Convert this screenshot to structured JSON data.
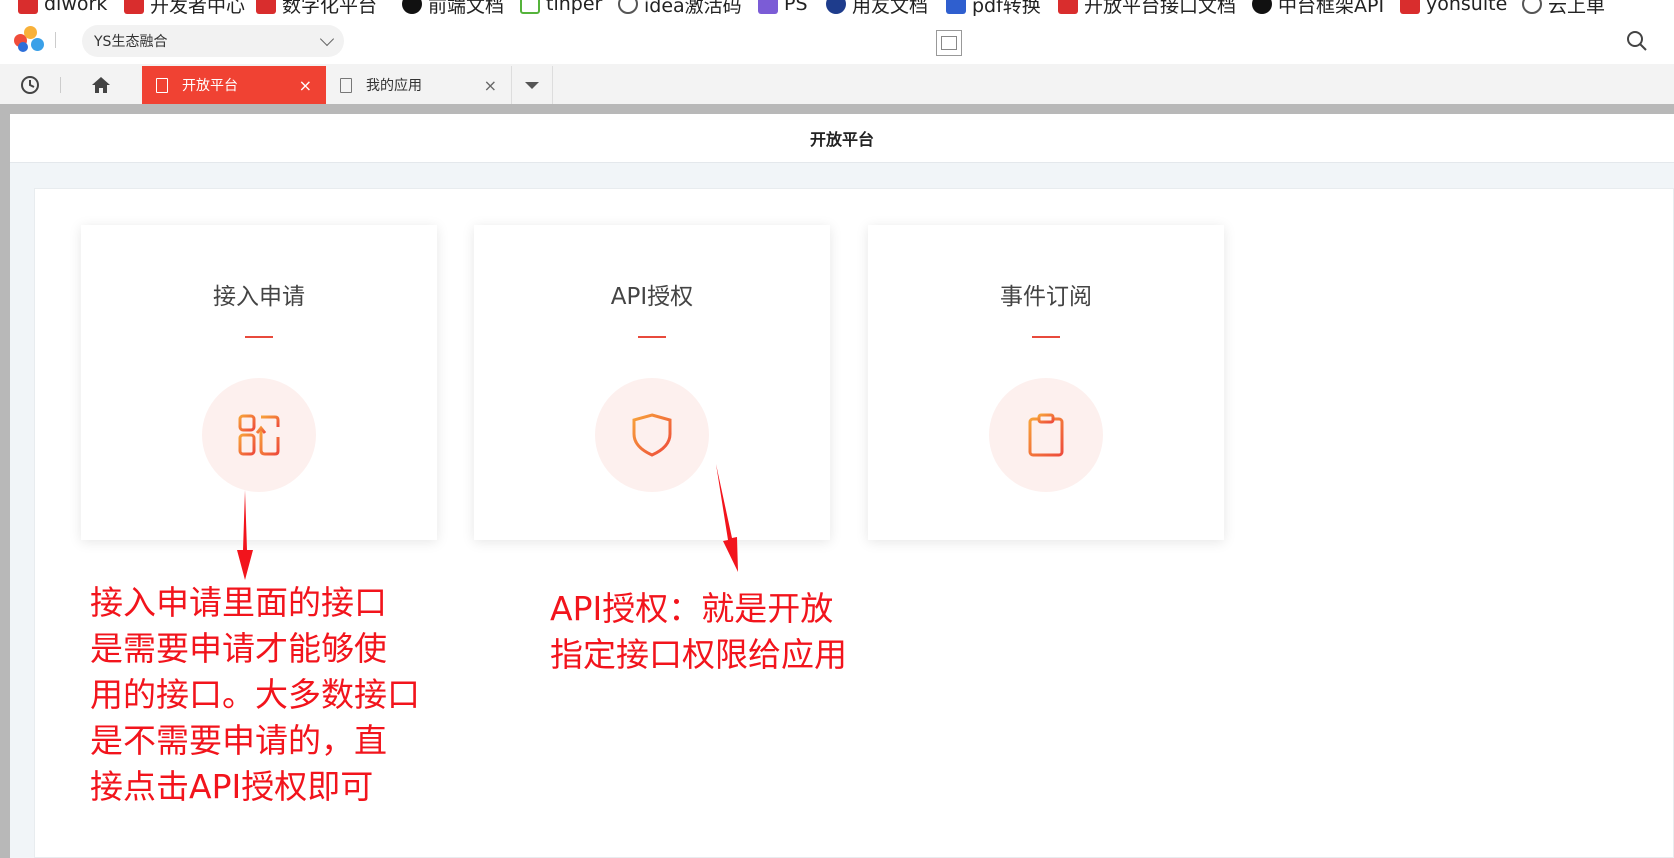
{
  "bookmarks": [
    {
      "label": "diwork",
      "icon": "app-icon"
    },
    {
      "label": "开发者中心",
      "icon": "app-icon"
    },
    {
      "label": "数字化平台",
      "icon": "app-icon"
    },
    {
      "label": "前端文档",
      "icon": "github-icon"
    },
    {
      "label": "tinper",
      "icon": "tinper-icon"
    },
    {
      "label": "idea激活码",
      "icon": "globe-icon"
    },
    {
      "label": "PS",
      "icon": "ps-icon"
    },
    {
      "label": "用友文档",
      "icon": "yonyou-icon"
    },
    {
      "label": "pdf转换",
      "icon": "pdf-icon"
    },
    {
      "label": "开放平台接口文档",
      "icon": "app-icon"
    },
    {
      "label": "中台框架API",
      "icon": "github-icon"
    },
    {
      "label": "yonsuite",
      "icon": "app-icon"
    },
    {
      "label": "云上单",
      "icon": "globe-icon"
    }
  ],
  "topbar": {
    "tenant": "YS生态融合"
  },
  "tabs": [
    {
      "label": "开放平台",
      "close": "×"
    },
    {
      "label": "我的应用",
      "close": "×"
    }
  ],
  "page": {
    "title": "开放平台"
  },
  "cards": [
    {
      "title": "接入申请",
      "icon": "api-connect-icon"
    },
    {
      "title": "API授权",
      "icon": "shield-chart-icon"
    },
    {
      "title": "事件订阅",
      "icon": "clipboard-icon"
    }
  ],
  "annotations": {
    "left": "接入申请里面的接口\n是需要申请才能够使\n用的接口。大多数接口\n是不需要申请的，直\n接点击API授权即可",
    "right": "API授权：就是开放\n指定接口权限给应用"
  },
  "colors": {
    "accent": "#f04233",
    "annotation": "#f2141c",
    "circle_bg": "#fdf0ee"
  }
}
